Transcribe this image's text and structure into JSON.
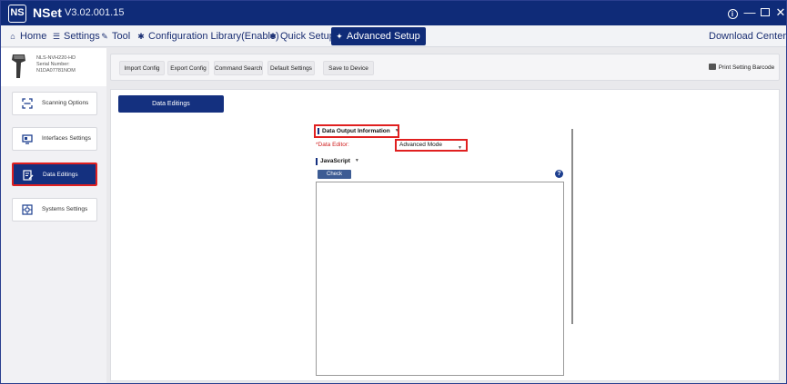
{
  "window": {
    "logo_text": "NS",
    "app_name": "NSet",
    "version": "V3.02.001.15",
    "controls": {
      "info": "i",
      "minimize": "—",
      "close": "✕"
    }
  },
  "menu": {
    "home": "Home",
    "settings": "Settings",
    "tool": "Tool",
    "config_library": "Configuration Library(Enable)",
    "quick_setup": "Quick Setup",
    "advanced_setup": "Advanced Setup",
    "download_center": "Download Center"
  },
  "device": {
    "model": "NLS-NVH220-HD",
    "serial_label": "Serial Number:",
    "serial": "N1DA07781NOM"
  },
  "toolbar": {
    "import": "Import Config",
    "export": "Export Config",
    "command_search": "Command Search",
    "default_settings": "Default Settings",
    "save_to_device": "Save to Device",
    "print_barcode": "Print Setting Barcode"
  },
  "sidebar": {
    "items": [
      {
        "label": "Scanning Options",
        "icon": "scan-icon",
        "active": false
      },
      {
        "label": "Interfaces Settings",
        "icon": "interface-icon",
        "active": false
      },
      {
        "label": "Data Editings",
        "icon": "edit-icon",
        "active": true
      },
      {
        "label": "Systems Settings",
        "icon": "system-icon",
        "active": false
      }
    ]
  },
  "content": {
    "tab_label": "Data Editings",
    "section_title": "Data Output Information",
    "data_editor_label": "*Data Editor:",
    "data_editor_value": "Advanced Mode",
    "js_section_title": "JavaScript",
    "check_button": "Check",
    "help": "?",
    "script_value": ""
  },
  "colors": {
    "brand": "#0f2b78",
    "active_nav": "#14307f",
    "highlight": "#e02020",
    "check_button": "#3d5c94"
  }
}
